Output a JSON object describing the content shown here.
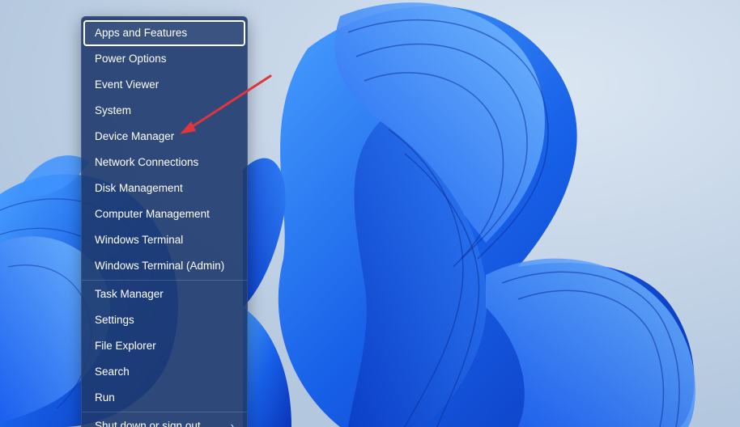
{
  "context_menu": {
    "items": [
      {
        "label": "Apps and Features"
      },
      {
        "label": "Power Options"
      },
      {
        "label": "Event Viewer"
      },
      {
        "label": "System"
      },
      {
        "label": "Device Manager"
      },
      {
        "label": "Network Connections"
      },
      {
        "label": "Disk Management"
      },
      {
        "label": "Computer Management"
      },
      {
        "label": "Windows Terminal"
      },
      {
        "label": "Windows Terminal (Admin)"
      },
      {
        "label": "Task Manager"
      },
      {
        "label": "Settings"
      },
      {
        "label": "File Explorer"
      },
      {
        "label": "Search"
      },
      {
        "label": "Run"
      },
      {
        "label": "Shut down or sign out"
      }
    ],
    "focused_item": "Apps and Features",
    "submenu_indicator": "chevron-right-icon"
  },
  "annotation": {
    "pointing_to": "Device Manager",
    "color": "#e0353a"
  },
  "colors": {
    "menu_background": "#1e3a6e",
    "wallpaper_accent": "#1a5fe0",
    "desktop_background": "#bfd0e3"
  }
}
